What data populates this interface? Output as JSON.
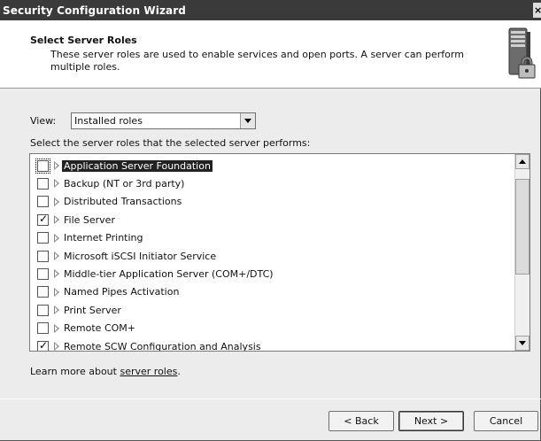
{
  "window": {
    "title": "Security Configuration Wizard",
    "close_glyph": "×"
  },
  "header": {
    "title": "Select Server Roles",
    "description": "These server roles are used to enable services and open ports. A server can perform multiple roles.",
    "icon": "server-lock-icon"
  },
  "view": {
    "label": "View:",
    "selected": "Installed roles"
  },
  "prompt": "Select the server roles that the selected server performs:",
  "roles": [
    {
      "label": "Application Server Foundation",
      "checked": false,
      "selected": true
    },
    {
      "label": "Backup (NT or 3rd party)",
      "checked": false
    },
    {
      "label": "Distributed Transactions",
      "checked": false
    },
    {
      "label": "File Server",
      "checked": true
    },
    {
      "label": "Internet Printing",
      "checked": false
    },
    {
      "label": "Microsoft iSCSI Initiator Service",
      "checked": false
    },
    {
      "label": "Middle-tier Application Server (COM+/DTC)",
      "checked": false
    },
    {
      "label": "Named Pipes Activation",
      "checked": false
    },
    {
      "label": "Print Server",
      "checked": false
    },
    {
      "label": "Remote COM+",
      "checked": false
    },
    {
      "label": "Remote SCW Configuration and Analysis",
      "checked": true
    }
  ],
  "learn_more": {
    "prefix": "Learn more about ",
    "link": "server roles",
    "suffix": "."
  },
  "buttons": {
    "back": "< Back",
    "next": "Next >",
    "cancel": "Cancel"
  }
}
